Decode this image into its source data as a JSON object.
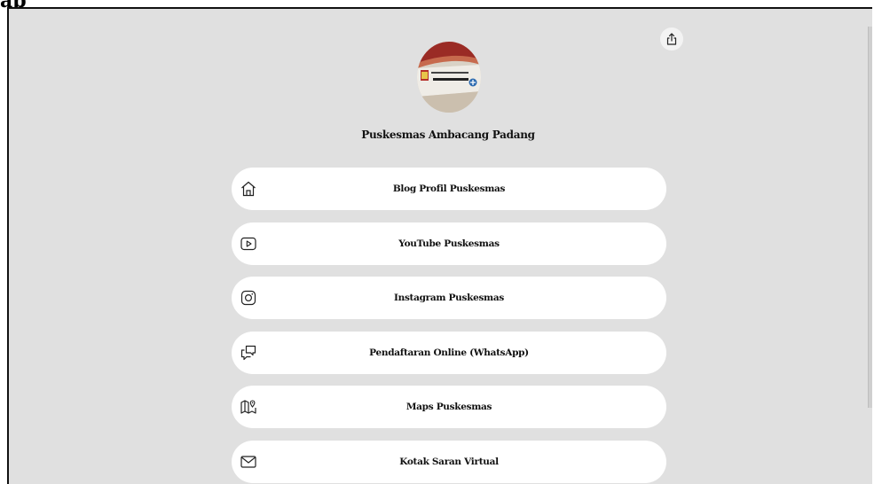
{
  "header_fragment": "ap",
  "profile": {
    "name": "Puskesmas Ambacang Padang",
    "avatar_icon": "profile-photo-icon"
  },
  "share": {
    "icon": "share-icon"
  },
  "links": [
    {
      "label": "Blog Profil Puskesmas",
      "icon": "home-icon"
    },
    {
      "label": "YouTube Puskesmas",
      "icon": "youtube-icon"
    },
    {
      "label": "Instagram Puskesmas",
      "icon": "instagram-icon"
    },
    {
      "label": "Pendaftaran Online (WhatsApp)",
      "icon": "chat-icon"
    },
    {
      "label": "Maps Puskesmas",
      "icon": "map-icon"
    },
    {
      "label": "Kotak Saran Virtual",
      "icon": "mail-icon"
    }
  ],
  "colors": {
    "background": "#e0e0e0",
    "button": "#ffffff",
    "text": "#111111"
  }
}
